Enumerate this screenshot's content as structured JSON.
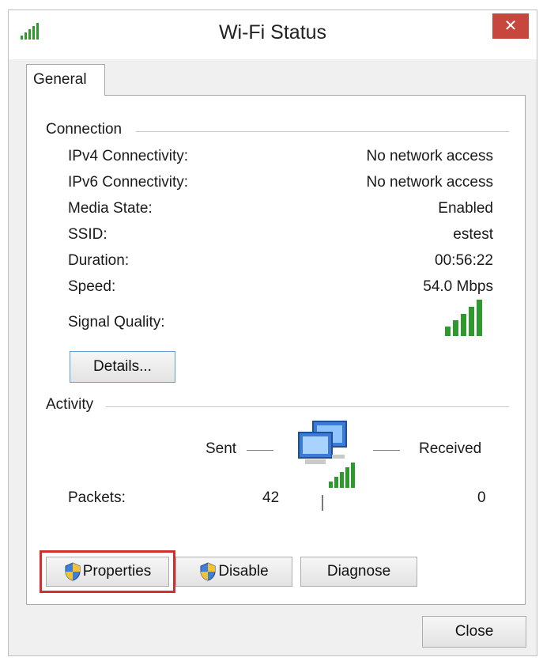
{
  "window": {
    "title": "Wi-Fi Status",
    "close_symbol": "✕"
  },
  "tabs": [
    {
      "label": "General"
    }
  ],
  "connection": {
    "heading": "Connection",
    "rows": [
      {
        "label": "IPv4 Connectivity:",
        "value": "No network access"
      },
      {
        "label": "IPv6 Connectivity:",
        "value": "No network access"
      },
      {
        "label": "Media State:",
        "value": "Enabled"
      },
      {
        "label": "SSID:",
        "value": "estest"
      },
      {
        "label": "Duration:",
        "value": "00:56:22"
      },
      {
        "label": "Speed:",
        "value": "54.0 Mbps"
      }
    ],
    "signal_label": "Signal Quality:",
    "signal_bars": 5,
    "details_button": "Details..."
  },
  "activity": {
    "heading": "Activity",
    "sent_label": "Sent",
    "received_label": "Received",
    "packets_label": "Packets:",
    "packets_sent": "42",
    "packets_received": "0"
  },
  "buttons": {
    "properties": "Properties",
    "disable": "Disable",
    "diagnose": "Diagnose",
    "close": "Close"
  },
  "icons": {
    "title": "wifi-signal-icon",
    "signal": "signal-bars-icon",
    "network": "network-computers-icon",
    "shield": "uac-shield-icon"
  },
  "colors": {
    "signal_green": "#2e9a2e",
    "close_red": "#c7473f",
    "highlight_red": "#d32f2f"
  }
}
